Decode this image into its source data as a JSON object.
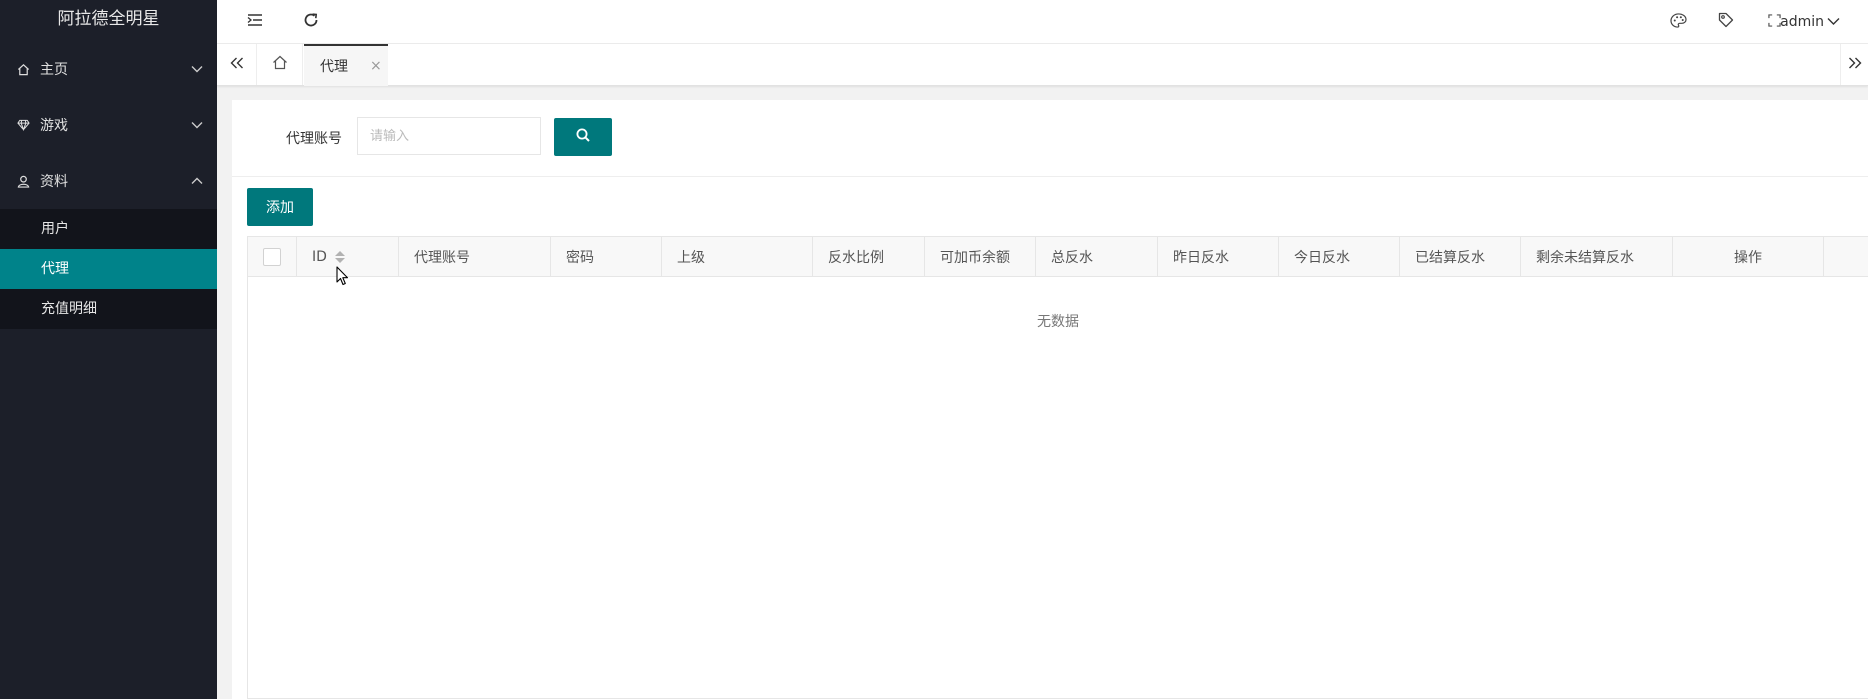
{
  "app": {
    "title": "阿拉德全明星"
  },
  "sidebar": {
    "menus": [
      {
        "label": "主页",
        "icon": "home-icon",
        "expanded": false
      },
      {
        "label": "游戏",
        "icon": "diamond-icon",
        "expanded": false
      },
      {
        "label": "资料",
        "icon": "user-icon",
        "expanded": true
      }
    ],
    "subitems": [
      {
        "label": "用户",
        "active": false
      },
      {
        "label": "代理",
        "active": true
      },
      {
        "label": "充值明细",
        "active": false
      }
    ]
  },
  "header": {
    "user": "admin"
  },
  "tabs": {
    "active_label": "代理",
    "close_glyph": "×"
  },
  "search": {
    "label": "代理账号",
    "placeholder": "请输入"
  },
  "toolbar": {
    "add_label": "添加"
  },
  "table": {
    "columns": [
      "ID",
      "代理账号",
      "密码",
      "上级",
      "反水比例",
      "可加币余额",
      "总反水",
      "昨日反水",
      "今日反水",
      "已结算反水",
      "剩余未结算反水",
      "操作"
    ],
    "rows": [],
    "empty_text": "无数据"
  },
  "colors": {
    "sidebar_bg": "#1c1f29",
    "accent": "#00838a",
    "button": "#00787c"
  }
}
